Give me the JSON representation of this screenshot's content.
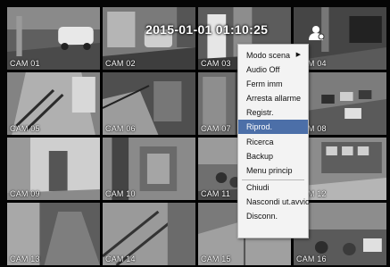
{
  "overlay": {
    "datetime": "2015-01-01 01:10:25"
  },
  "cameras": [
    {
      "label": "CAM 01"
    },
    {
      "label": "CAM 02"
    },
    {
      "label": "CAM 03"
    },
    {
      "label": "CAM 04"
    },
    {
      "label": "CAM 05"
    },
    {
      "label": "CAM 06"
    },
    {
      "label": "CAM 07"
    },
    {
      "label": "CAM 08"
    },
    {
      "label": "CAM 09"
    },
    {
      "label": "CAM 10"
    },
    {
      "label": "CAM 11"
    },
    {
      "label": "CAM 12"
    },
    {
      "label": "CAM 13"
    },
    {
      "label": "CAM 14"
    },
    {
      "label": "CAM 15"
    },
    {
      "label": "CAM 16"
    }
  ],
  "context_menu": {
    "items": [
      {
        "label": "Modo scena",
        "submenu_arrow": "▶"
      },
      {
        "label": "Audio Off"
      },
      {
        "label": "Ferm imm"
      },
      {
        "label": "Arresta allarme"
      },
      {
        "label": "Registr."
      },
      {
        "label": "Riprod."
      },
      {
        "label": "Ricerca"
      },
      {
        "label": "Backup"
      },
      {
        "label": "Menu princip"
      },
      {
        "label": "Chiudi"
      },
      {
        "label": "Nascondi ut.avvio"
      },
      {
        "label": "Disconn."
      }
    ],
    "selected_label": "Riprod."
  },
  "colors": {
    "menu_background": "#f3f3f3",
    "menu_highlight": "#4c6fa8",
    "screen_background": "#050505"
  },
  "icons": {
    "user_icon": "user-icon"
  }
}
